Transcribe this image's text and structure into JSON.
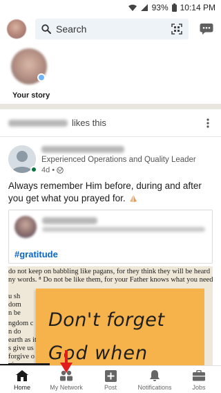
{
  "status_bar": {
    "battery": "93%",
    "time": "10:14 PM"
  },
  "header": {
    "search_placeholder": "Search"
  },
  "stories": {
    "label": "Your story"
  },
  "feed": {
    "activity_text": "likes this",
    "post": {
      "headline": "Experienced Operations and Quality Leader",
      "age": "4d",
      "text": "Always remember Him before, during and after you get what you prayed for.",
      "shared": {
        "hashtag": "#gratitude"
      },
      "image": {
        "bible_lines": [
          "do not keep on babbling like pagans, for they think they will be heard",
          "ny words. ⁸ Do not be like them, for your Father knows what you need"
        ],
        "bible_left": [
          "u sh",
          "dom",
          "n be",
          "ngdom c",
          "n do",
          "earth as it",
          "s give us",
          "forgive o",
          "gi"
        ],
        "note_lines": [
          "Don't forget",
          "God   when"
        ]
      }
    }
  },
  "bottom_nav": {
    "items": [
      {
        "label": "Home",
        "icon": "home-icon"
      },
      {
        "label": "My Network",
        "icon": "network-icon"
      },
      {
        "label": "Post",
        "icon": "post-icon"
      },
      {
        "label": "Notifications",
        "icon": "bell-icon"
      },
      {
        "label": "Jobs",
        "icon": "briefcase-icon"
      }
    ]
  },
  "colors": {
    "accent": "#0a66c2",
    "search_bg": "#eef3f8",
    "online": "#057642",
    "annotation_arrow": "#e21d1d",
    "sticky_note": "#f6b24b"
  }
}
